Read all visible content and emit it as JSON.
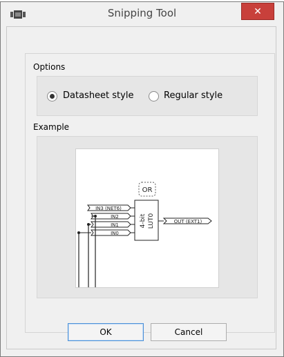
{
  "window": {
    "title": "Snipping Tool",
    "close_glyph": "✕"
  },
  "options": {
    "label": "Options",
    "items": [
      {
        "label": "Datasheet style",
        "selected": true
      },
      {
        "label": "Regular style",
        "selected": false
      }
    ]
  },
  "example": {
    "label": "Example",
    "gate_badge": "OR",
    "lut_label_1": "4-bit",
    "lut_label_2": "LUT0",
    "inputs": [
      "IN3 (NET6)",
      "IN2",
      "IN1",
      "IN0"
    ],
    "output": "OUT (EXT1)"
  },
  "buttons": {
    "ok": "OK",
    "cancel": "Cancel"
  },
  "icons": {
    "app": "snipping-tool-icon",
    "close": "close-icon"
  },
  "colors": {
    "close_bg": "#c8403b",
    "ok_border": "#4a8fd7"
  }
}
